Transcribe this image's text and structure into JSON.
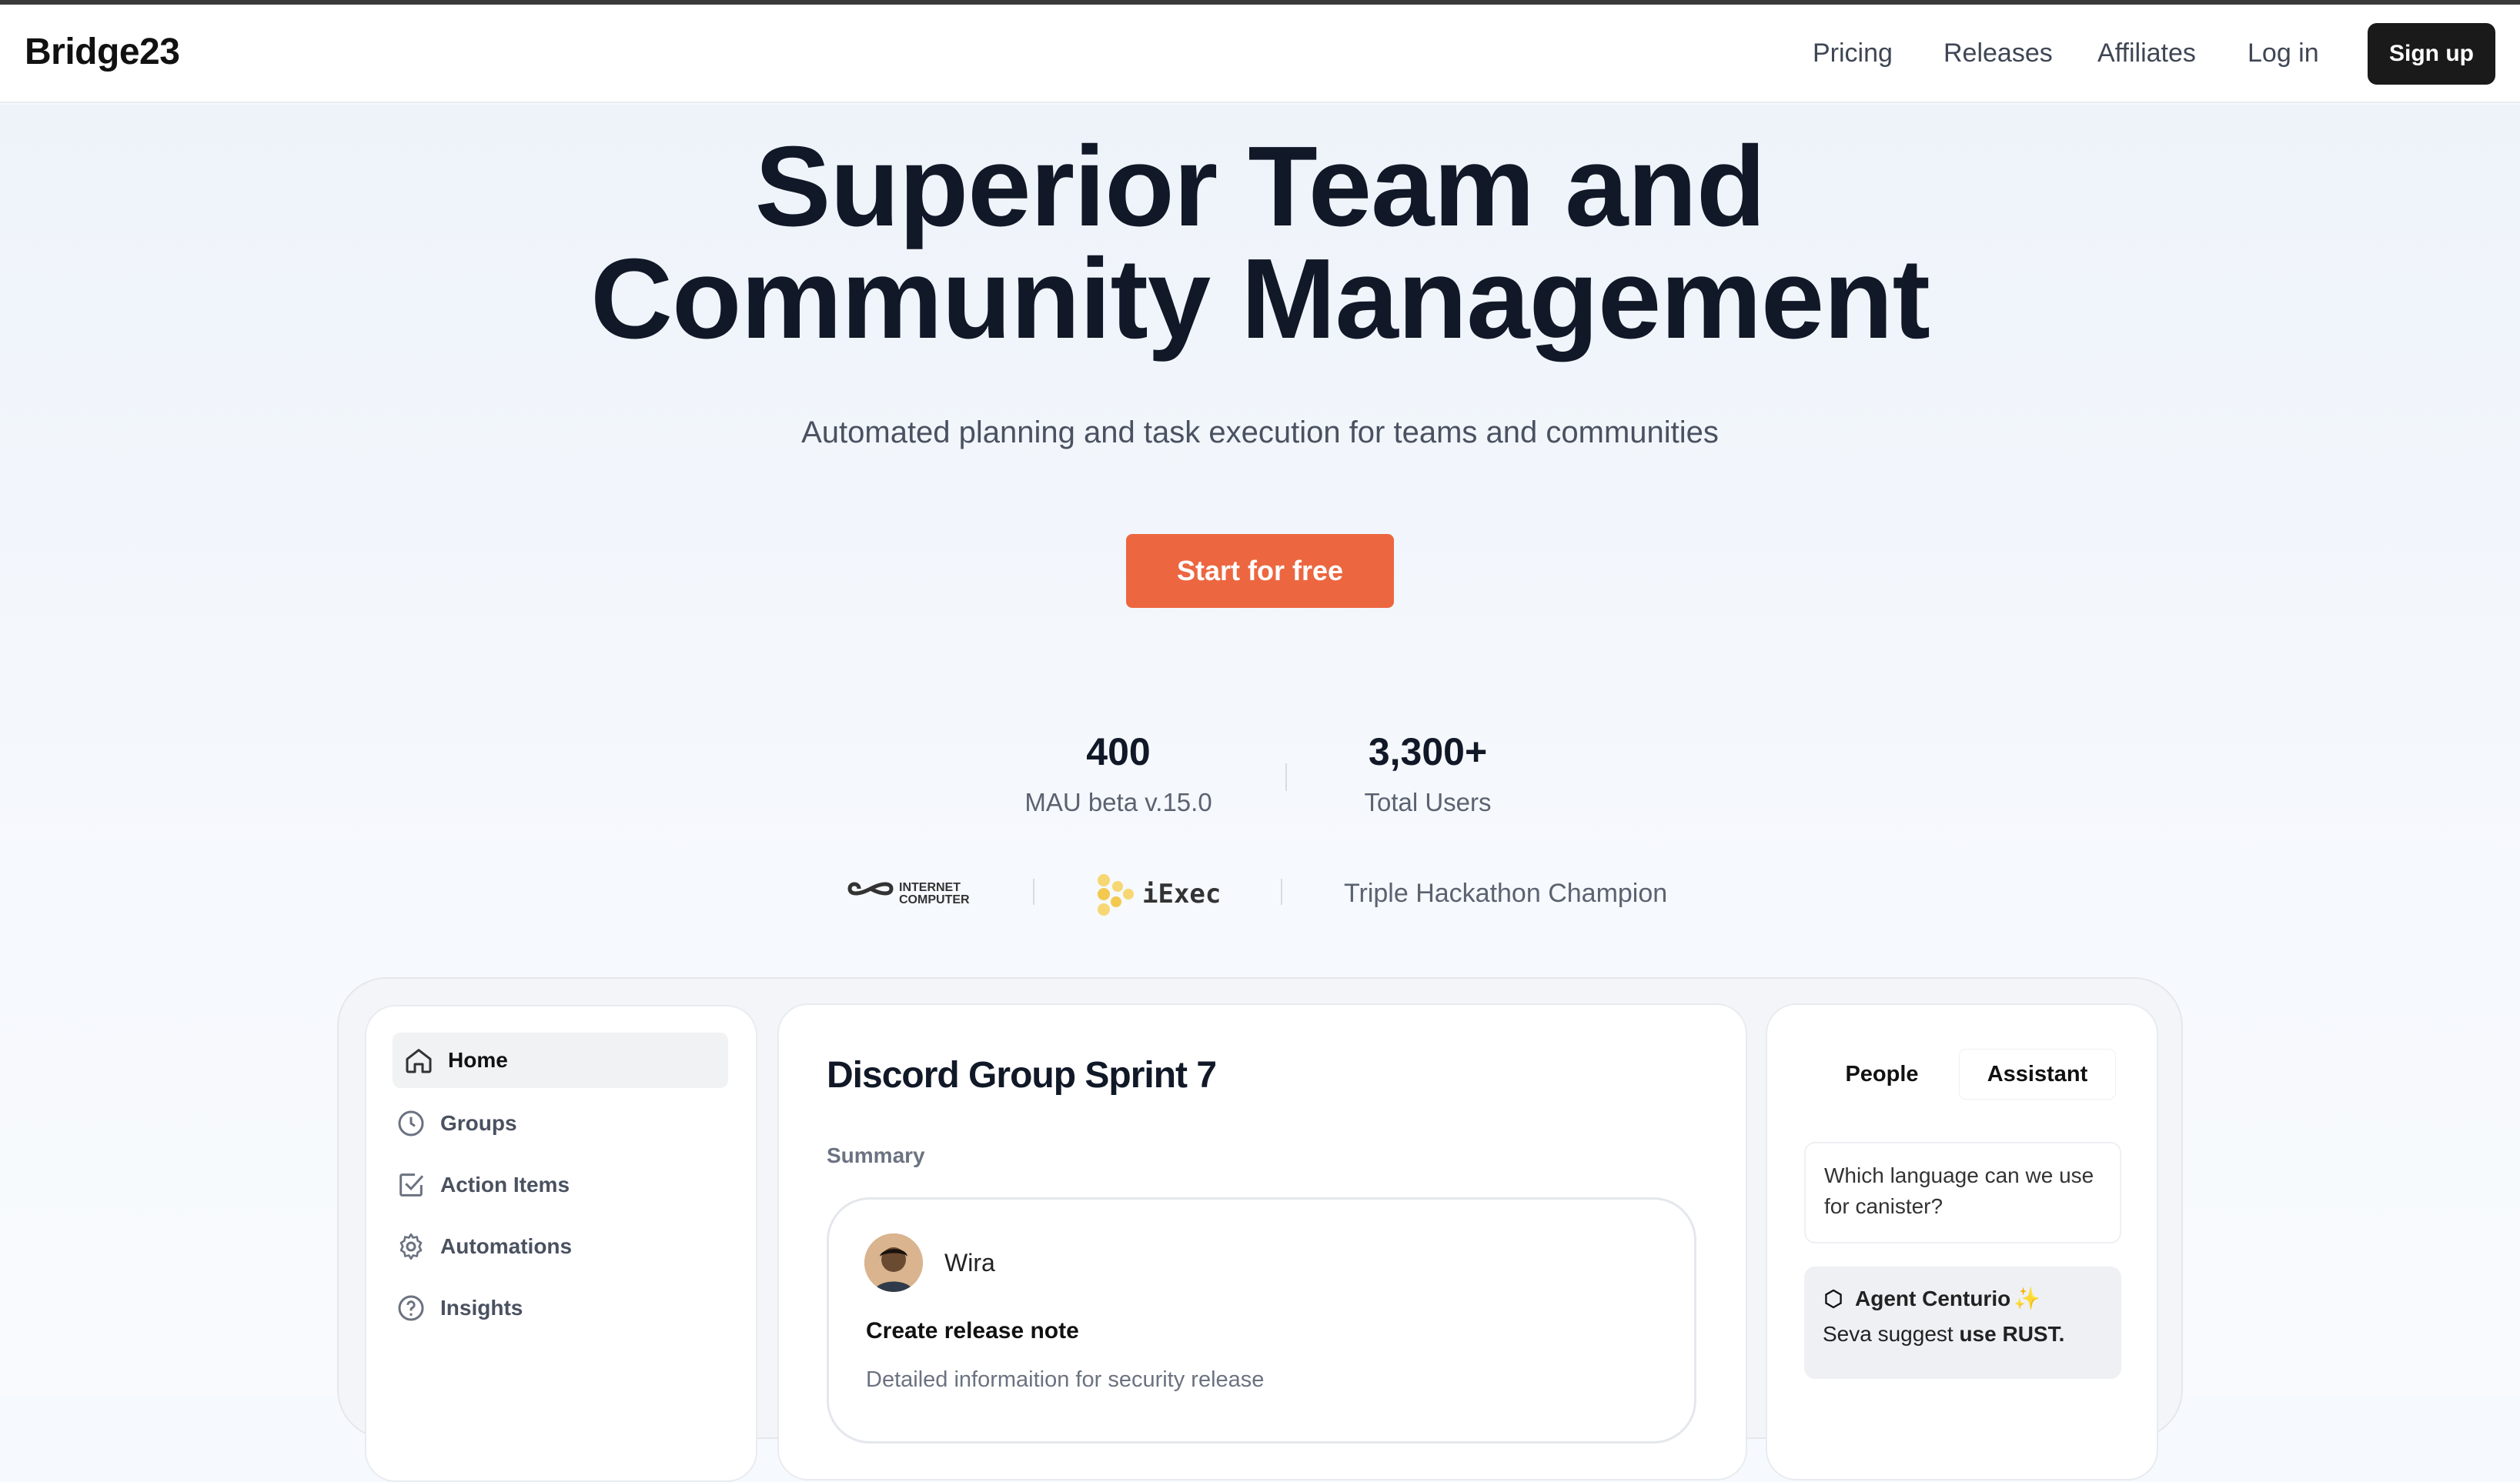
{
  "nav": {
    "logo": "Bridge23",
    "links": [
      "Pricing",
      "Releases",
      "Affiliates",
      "Log in"
    ],
    "signup": "Sign up"
  },
  "hero": {
    "headline_line1": "Superior Team and",
    "headline_line2": "Community Management",
    "subtitle": "Automated planning and task execution for teams and communities",
    "cta": "Start for free"
  },
  "stats": [
    {
      "value": "400",
      "label": "MAU beta v.15.0"
    },
    {
      "value": "3,300+",
      "label": "Total Users"
    }
  ],
  "partners": {
    "ic_line1": "INTERNET",
    "ic_line2": "COMPUTER",
    "iexec": "iExec",
    "hackathon": "Triple Hackathon Champion"
  },
  "app": {
    "sidebar": [
      "Home",
      "Groups",
      "Action Items",
      "Automations",
      "Insights"
    ],
    "title": "Discord Group Sprint 7",
    "summary_label": "Summary",
    "card": {
      "user": "Wira",
      "task": "Create release note",
      "desc": "Detailed informaition for security release"
    },
    "tabs": [
      "People",
      "Assistant"
    ],
    "question": "Which language can we use for canister?",
    "agent_name": "Agent Centurio",
    "agent_msg_prefix": "Seva suggest ",
    "agent_msg_bold": "use RUST."
  },
  "colors": {
    "accent": "#ec6640",
    "dark": "#1a1a1a",
    "text": "#111827"
  }
}
